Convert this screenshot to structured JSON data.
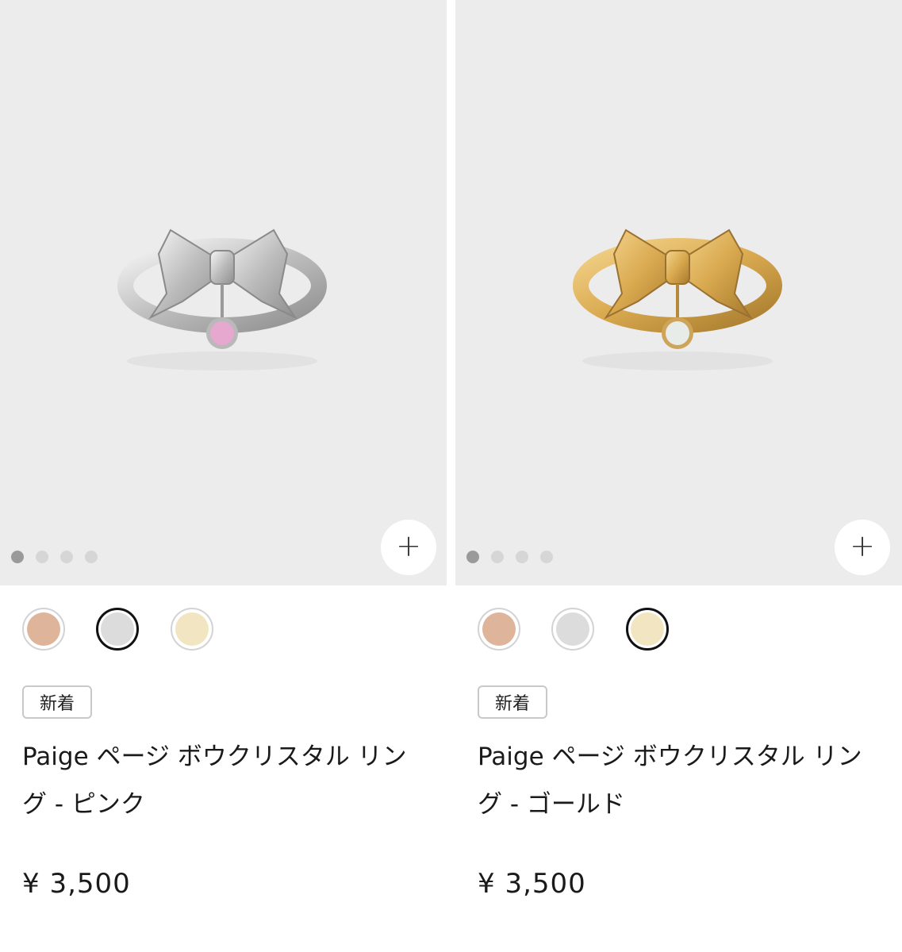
{
  "products": [
    {
      "image_dots": 4,
      "active_dot": 0,
      "add_label": "+",
      "swatch_colors": [
        "#deb49a",
        "#dcdcdc",
        "#f2e6c2"
      ],
      "selected_swatch": 1,
      "badge": "新着",
      "title": "Paige ページ ボウクリスタル リング - ピンク",
      "price": "¥ 3,500",
      "metal_color": "#c9c9c9",
      "stone_color": "#e6a8cf"
    },
    {
      "image_dots": 4,
      "active_dot": 0,
      "add_label": "+",
      "swatch_colors": [
        "#deb49a",
        "#dcdcdc",
        "#f2e6c2"
      ],
      "selected_swatch": 2,
      "badge": "新着",
      "title": "Paige ページ ボウクリスタル リング - ゴールド",
      "price": "¥ 3,500",
      "metal_color": "#e0b45e",
      "stone_color": "#e8ece9"
    }
  ]
}
